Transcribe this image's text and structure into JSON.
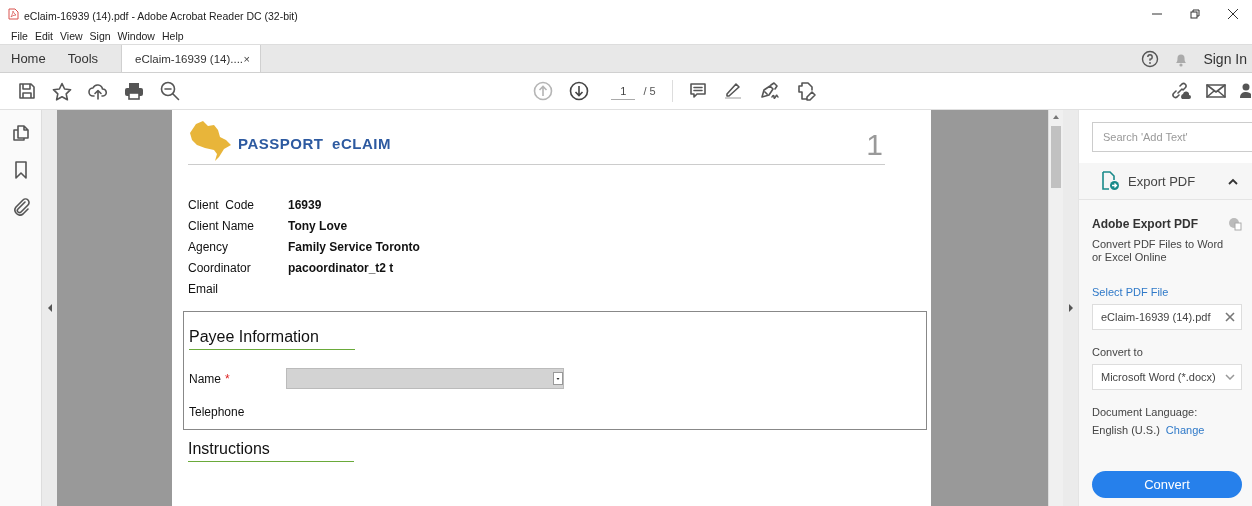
{
  "window": {
    "title": "eClaim-16939 (14).pdf - Adobe Acrobat Reader DC (32-bit)"
  },
  "menu": [
    "File",
    "Edit",
    "View",
    "Sign",
    "Window",
    "Help"
  ],
  "tabs": [
    {
      "label": "Home",
      "selected": false
    },
    {
      "label": "Tools",
      "selected": false
    },
    {
      "label": "eClaim-16939 (14)....",
      "selected": true,
      "close": "×"
    }
  ],
  "account": {
    "sign_in": "Sign In"
  },
  "page_nav": {
    "prev_disabled": true,
    "next_disabled": false,
    "current": "1",
    "total": "/ 5"
  },
  "document": {
    "logo": "PASSPORT eCLAIM",
    "page_number": "1",
    "fields": [
      {
        "label": "Client  Code",
        "value": "16939"
      },
      {
        "label": "Client Name",
        "value": "Tony Love"
      },
      {
        "label": "Agency",
        "value": "Family Service Toronto"
      },
      {
        "label": "Coordinator",
        "value": "pacoordinator_t2 t"
      },
      {
        "label": "Email"
      }
    ],
    "sections": [
      {
        "title": "Payee Information",
        "fields": [
          {
            "label": "Name",
            "required_mark": "*",
            "kind": "dropdown"
          },
          {
            "label": "Telephone",
            "kind": "text"
          }
        ]
      },
      {
        "title": "Instructions"
      }
    ]
  },
  "right_panel": {
    "search": {
      "placeholder": "Search 'Add Text'"
    },
    "tool": {
      "label": "Export PDF",
      "expanded": true
    },
    "title": "Adobe Export PDF",
    "description": "Convert PDF Files to Word or Excel Online",
    "select_link": "Select PDF File",
    "file": "eClaim-16939 (14).pdf",
    "convert_label": "Convert to",
    "format": "Microsoft Word (*.docx)",
    "language_label": "Document Language:",
    "language": "English (U.S.)",
    "change_link": "Change",
    "button": "Convert"
  }
}
